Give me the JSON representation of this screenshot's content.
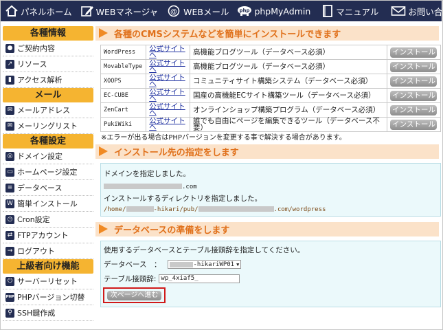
{
  "nav": [
    {
      "label": "パネルホーム",
      "icon": "home-icon"
    },
    {
      "label": "WEBマネージャ",
      "icon": "pencil-icon"
    },
    {
      "label": "WEBメール",
      "icon": "at-sign-icon"
    },
    {
      "label": "phpMyAdmin",
      "icon": "php-elephant-icon"
    },
    {
      "label": "マニュアル",
      "icon": "book-icon"
    },
    {
      "label": "お問い合わせ",
      "icon": "mail-icon"
    }
  ],
  "sidebar": {
    "groups": [
      {
        "heading": "各種情報",
        "items": [
          {
            "label": "ご契約内容",
            "icon": "person-icon"
          },
          {
            "label": "リソース",
            "icon": "chart-icon"
          },
          {
            "label": "アクセス解析",
            "icon": "bar-chart-icon"
          }
        ]
      },
      {
        "heading": "メール",
        "items": [
          {
            "label": "メールアドレス",
            "icon": "envelope-icon"
          },
          {
            "label": "メーリングリスト",
            "icon": "mailing-list-icon"
          }
        ]
      },
      {
        "heading": "各種設定",
        "items": [
          {
            "label": "ドメイン設定",
            "icon": "globe-icon"
          },
          {
            "label": "ホームページ設定",
            "icon": "window-icon"
          },
          {
            "label": "データベース",
            "icon": "database-icon"
          },
          {
            "label": "簡単インストール",
            "icon": "wordpress-icon"
          },
          {
            "label": "Cron設定",
            "icon": "clock-icon"
          },
          {
            "label": "FTPアカウント",
            "icon": "ftp-icon"
          },
          {
            "label": "ログアウト",
            "icon": "logout-icon"
          }
        ]
      },
      {
        "heading": "上級者向け機能",
        "items": [
          {
            "label": "サーバーリセット",
            "icon": "power-icon"
          },
          {
            "label": "PHPバージョン切替",
            "icon": "php-icon"
          },
          {
            "label": "SSH鍵作成",
            "icon": "key-search-icon"
          }
        ]
      }
    ]
  },
  "cms_section": {
    "title": "各種のCMSシステムなどを簡単にインストールできます",
    "rows": [
      {
        "name": "WordPress",
        "site": "公式サイトへ",
        "desc": "高機能ブログツール（データベース必須）",
        "button": "インストール"
      },
      {
        "name": "MovableType",
        "site": "公式サイトへ",
        "desc": "高機能ブログツール（データベース必須）",
        "button": "インストール"
      },
      {
        "name": "XOOPS",
        "site": "公式サイトへ",
        "desc": "コミュニティサイト構築システム（データベース必須）",
        "button": "インストール"
      },
      {
        "name": "EC-CUBE",
        "site": "公式サイトへ",
        "desc": "国産の高機能ECサイト構築ツール（データベース必須）",
        "button": "インストール"
      },
      {
        "name": "ZenCart",
        "site": "公式サイトへ",
        "desc": "オンラインショップ構築プログラム（データベース必須）",
        "button": "インストール"
      },
      {
        "name": "PukiWiki",
        "site": "公式サイトへ",
        "desc": "誰でも自由にページを編集できるツール（データベース不要）",
        "button": "インストール"
      }
    ],
    "note": "※エラーが出る場合はPHPバージョンを変更する事で解決する場合があります。"
  },
  "install_section": {
    "title": "インストール先の指定をします",
    "domain_msg": "ドメインを指定しました。",
    "domain_value_suffix": ".com",
    "dir_msg": "インストールするディレクトリを指定しました。",
    "dir_part1": "/home/",
    "dir_part2": "-hikari/pub/",
    "dir_part3": ".com/wordpress"
  },
  "db_section": {
    "title": "データベースの準備をします",
    "instruction": "使用するデータベースとテーブル接頭辞を指定してください。",
    "db_label": "データベース　：",
    "db_value": "-hikariWP01",
    "prefix_label": "テーブル接頭辞:",
    "prefix_value": "wp_4xiaf5_",
    "next_button": "次ページへ進む"
  },
  "colors": {
    "nav_bg": "#232d52",
    "side_head": "#f5b431",
    "section_head_text": "#e0701a",
    "highlight_border": "#d01a1a"
  }
}
